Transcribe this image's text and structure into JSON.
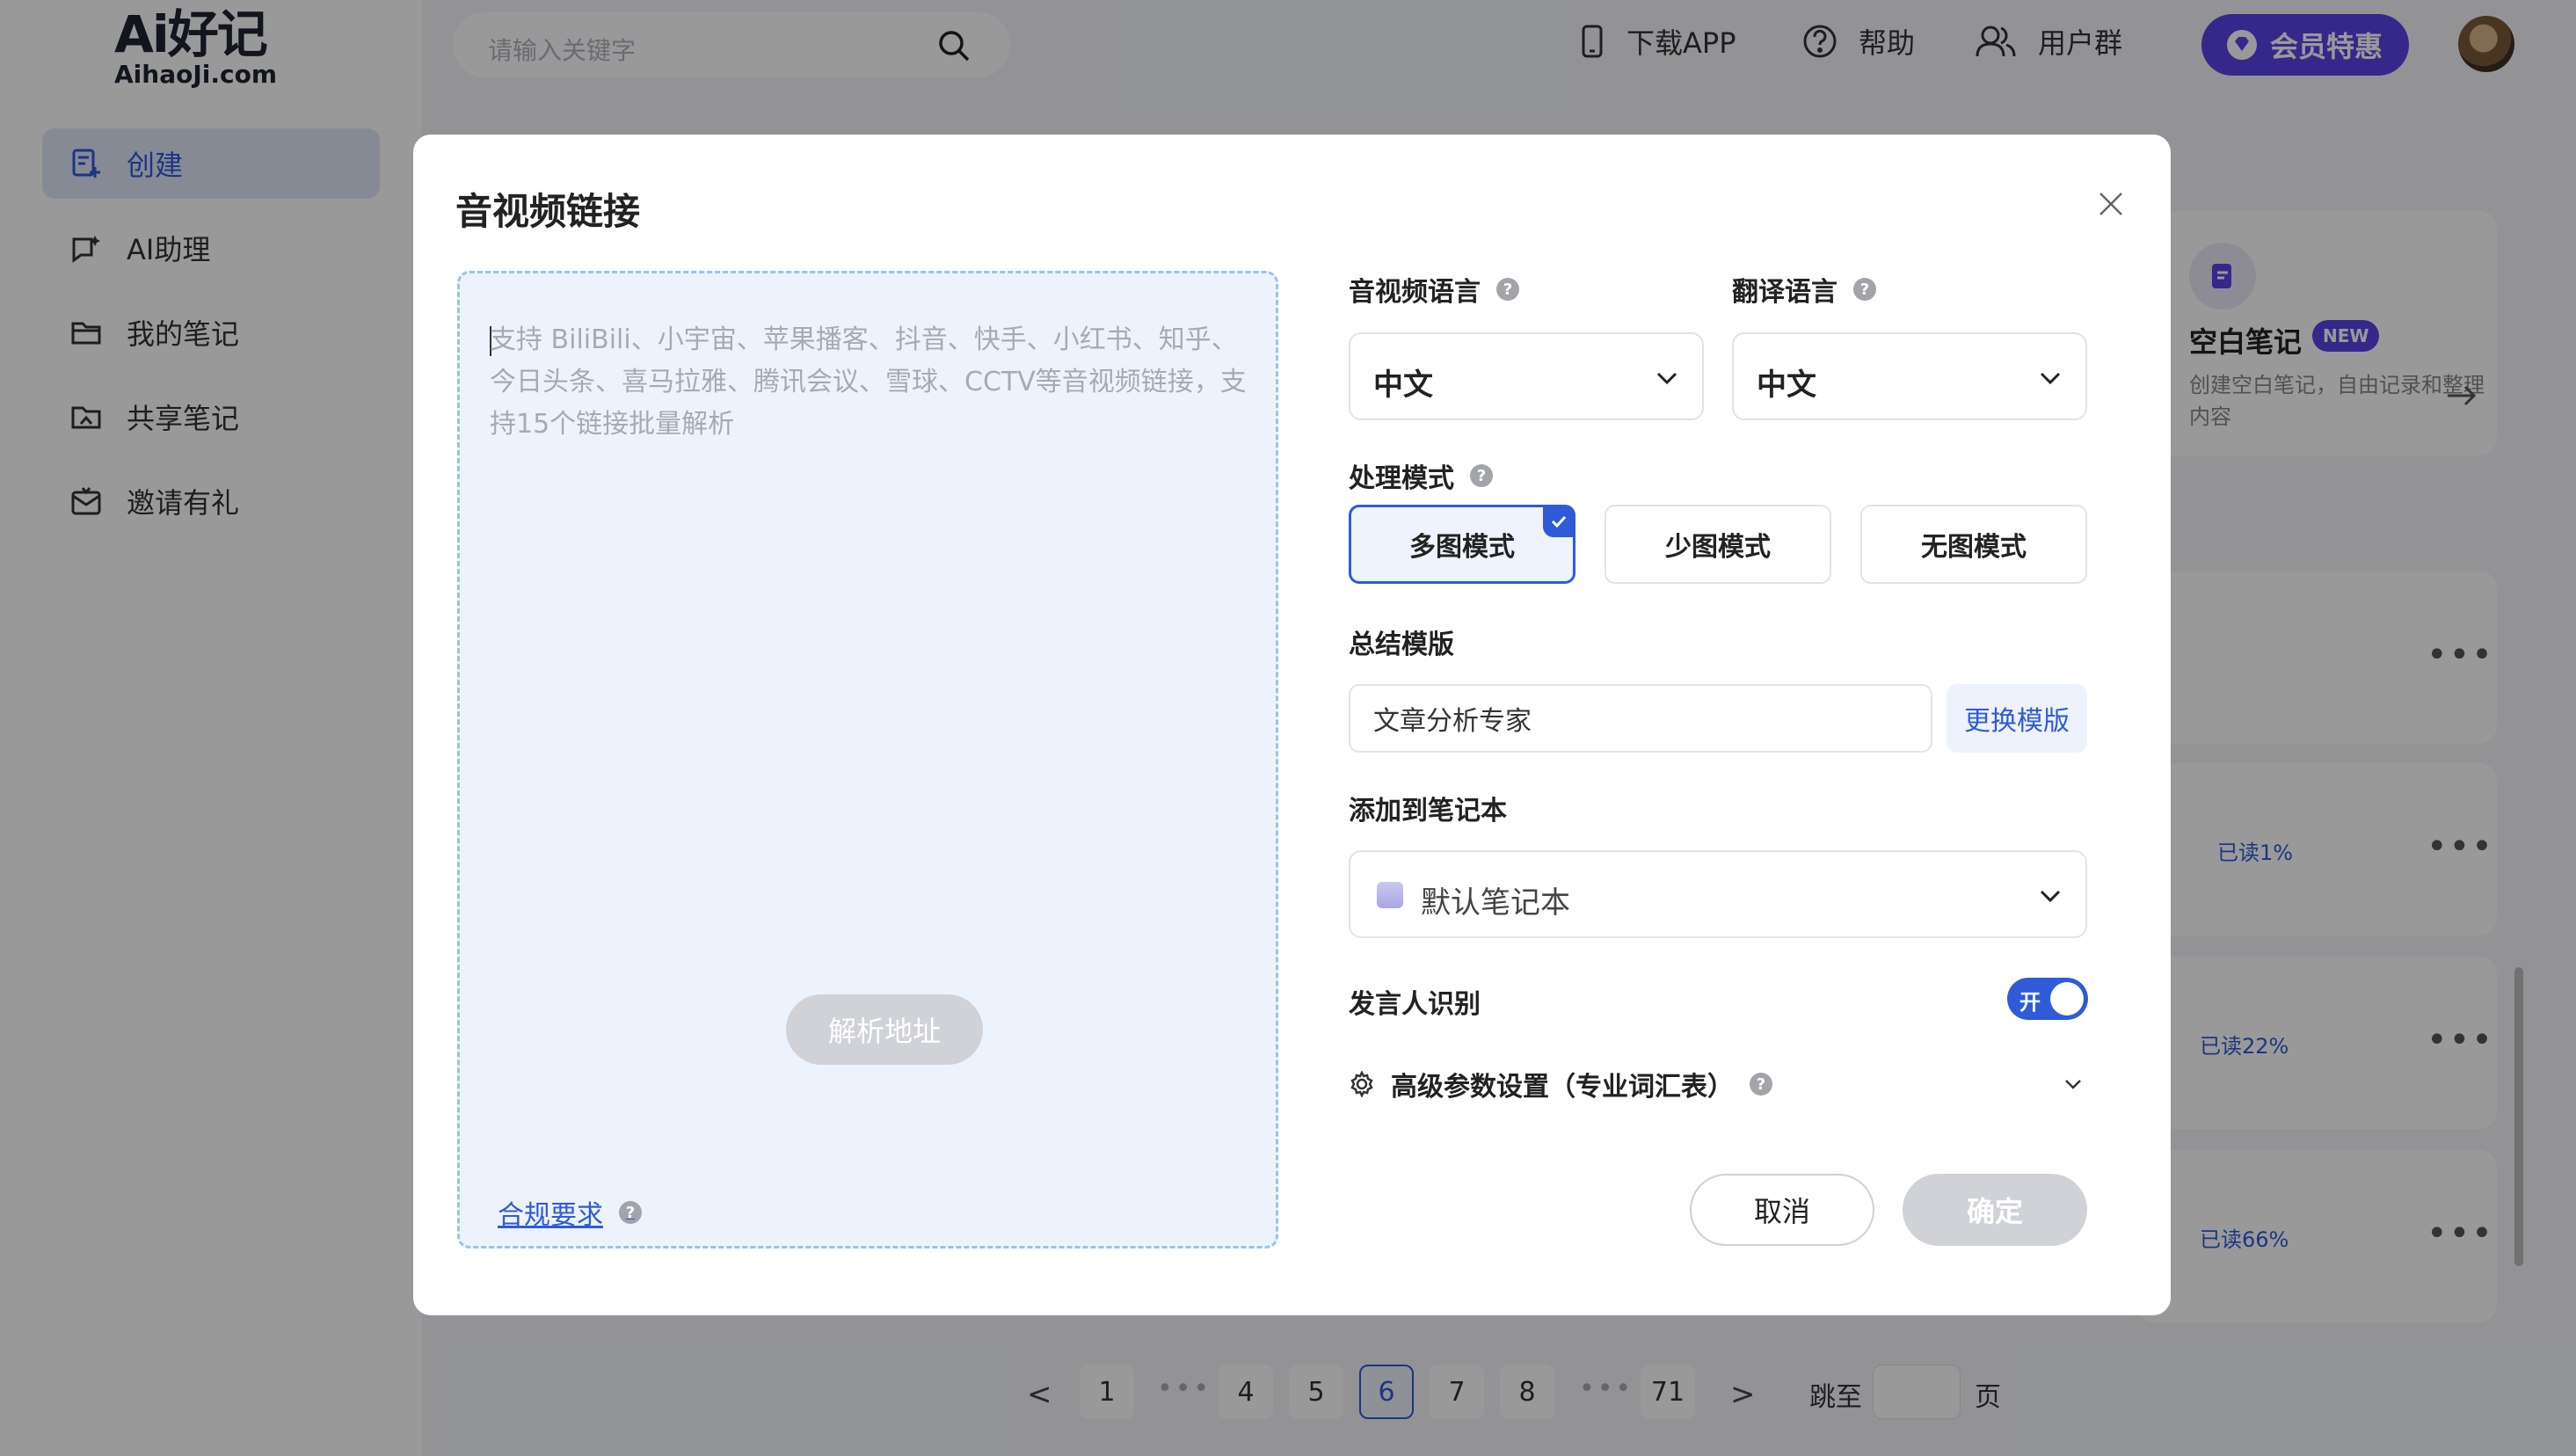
{
  "app": {
    "logo_main": "Ai好记",
    "logo_sub": "AihaoJi.com"
  },
  "sidebar": {
    "items": [
      {
        "label": "创建",
        "icon": "create-icon",
        "active": true
      },
      {
        "label": "AI助理",
        "icon": "ai-assistant-icon",
        "active": false
      },
      {
        "label": "我的笔记",
        "icon": "folder-icon",
        "active": false
      },
      {
        "label": "共享笔记",
        "icon": "shared-folder-icon",
        "active": false
      },
      {
        "label": "邀请有礼",
        "icon": "gift-mail-icon",
        "active": false
      }
    ]
  },
  "header": {
    "search_placeholder": "请输入关键字",
    "download_app": "下载APP",
    "help": "帮助",
    "user_group": "用户群",
    "vip": "会员特惠"
  },
  "background": {
    "blank_note_title": "空白笔记",
    "blank_note_badge": "NEW",
    "blank_note_desc": "创建空白笔记，自由记录和整理内容",
    "cards": [
      {
        "progress": ""
      },
      {
        "progress": "已读1%"
      },
      {
        "progress": "已读22%"
      },
      {
        "progress": "已读66%"
      }
    ],
    "more_label": "•••"
  },
  "pagination": {
    "prev": "<",
    "next": ">",
    "pages": [
      "1",
      "4",
      "5",
      "6",
      "7",
      "8",
      "71"
    ],
    "current": "6",
    "dots": "•••",
    "jump_to": "跳至",
    "page_unit": "页"
  },
  "modal": {
    "title": "音视频链接",
    "close_icon": "close-icon",
    "textarea_placeholder": "支持 BiliBili、小宇宙、苹果播客、抖音、快手、小红书、知乎、今日头条、喜马拉雅、腾讯会议、雪球、CCTV等音视频链接，支持15个链接批量解析",
    "parse_button": "解析地址",
    "av_language_label": "音视频语言",
    "av_language_value": "中文",
    "translate_language_label": "翻译语言",
    "translate_language_value": "中文",
    "processing_mode_label": "处理模式",
    "modes": [
      "多图模式",
      "少图模式",
      "无图模式"
    ],
    "selected_mode": "多图模式",
    "summary_template_label": "总结模版",
    "summary_template_value": "文章分析专家",
    "change_template_button": "更换模版",
    "notebook_label": "添加到笔记本",
    "notebook_value": "默认笔记本",
    "speaker_label": "发言人识别",
    "speaker_toggle_text": "开",
    "speaker_enabled": true,
    "advanced_label": "高级参数设置（专业词汇表）",
    "compliance_link": "合规要求",
    "cancel_button": "取消",
    "confirm_button": "确定",
    "help_mark": "?"
  },
  "colors": {
    "accent": "#2f5bd8",
    "vip": "#5b43e6",
    "disabled": "#d0d2d7",
    "dropzone_bg": "#edf3fc",
    "dropzone_border": "#98c3ea"
  }
}
